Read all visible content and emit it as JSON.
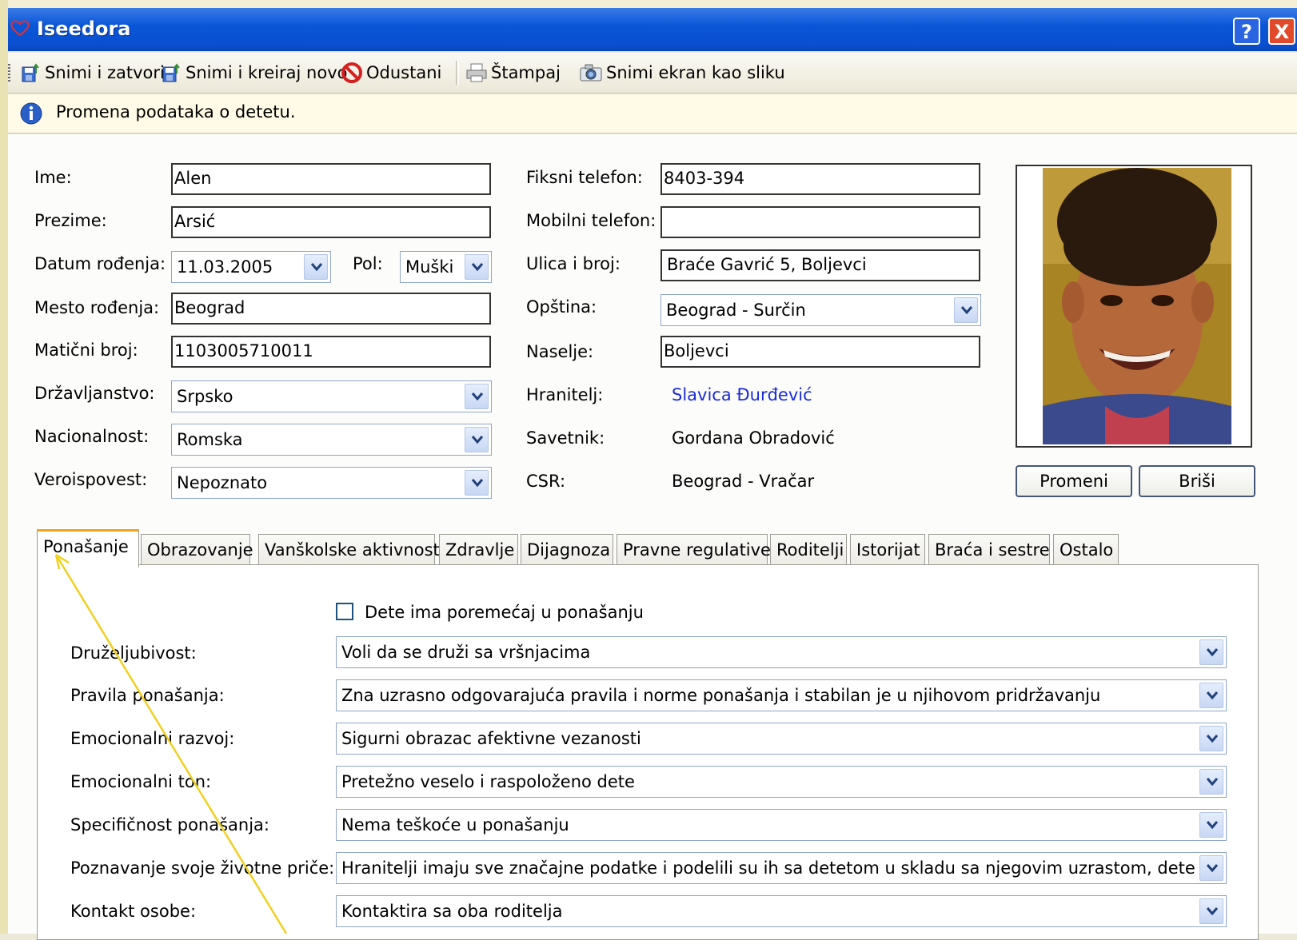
{
  "window": {
    "title": "Iseedora",
    "help_label": "?",
    "close_label": "X"
  },
  "toolbar": {
    "save_close": "Snimi i zatvori",
    "save_new": "Snimi i kreiraj novo",
    "cancel": "Odustani",
    "print": "Štampaj",
    "screenshot": "Snimi ekran kao sliku"
  },
  "info": {
    "message": "Promena podataka o detetu."
  },
  "form": {
    "ime": {
      "label": "Ime:",
      "value": "Alen"
    },
    "prezime": {
      "label": "Prezime:",
      "value": "Arsić"
    },
    "datum": {
      "label": "Datum rođenja:",
      "value": "11.03.2005"
    },
    "pol": {
      "label": "Pol:",
      "value": "Muški"
    },
    "mesto": {
      "label": "Mesto rođenja:",
      "value": "Beograd"
    },
    "maticni": {
      "label": "Matični broj:",
      "value": "1103005710011"
    },
    "drzavljanstvo": {
      "label": "Državljanstvo:",
      "value": "Srpsko"
    },
    "nacionalnost": {
      "label": "Nacionalnost:",
      "value": "Romska"
    },
    "veroispovest": {
      "label": "Veroispovest:",
      "value": "Nepoznato"
    },
    "fiksni": {
      "label": "Fiksni telefon:",
      "value": "8403-394"
    },
    "mobilni": {
      "label": "Mobilni telefon:",
      "value": ""
    },
    "ulica": {
      "label": "Ulica i broj:",
      "value": "Braće Gavrić 5, Boljevci"
    },
    "opstina": {
      "label": "Opština:",
      "value": "Beograd - Surčin"
    },
    "naselje": {
      "label": "Naselje:",
      "value": "Boljevci"
    },
    "hranitelj": {
      "label": "Hranitelj:",
      "value": "Slavica Đurđević"
    },
    "savetnik": {
      "label": "Savetnik:",
      "value": "Gordana Obradović"
    },
    "csr": {
      "label": "CSR:",
      "value": "Beograd - Vračar"
    }
  },
  "photo": {
    "change": "Promeni",
    "delete": "Briši"
  },
  "tabs": [
    "Ponašanje",
    "Obrazovanje",
    "Vanškolske aktivnosti",
    "Zdravlje",
    "Dijagnoza",
    "Pravne regulative",
    "Roditelji",
    "Istorijat",
    "Braća i sestre",
    "Ostalo"
  ],
  "behavior": {
    "checkbox_label": "Dete ima poremećaj u ponašanju",
    "checked": false,
    "rows": [
      {
        "label": "Druželjubivost:",
        "value": "Voli da se druži sa vršnjacima"
      },
      {
        "label": "Pravila ponašanja:",
        "value": "Zna uzrasno odgovarajuća pravila i norme ponašanja i stabilan je u njihovom pridržavanju"
      },
      {
        "label": "Emocionalni razvoj:",
        "value": "Sigurni obrazac afektivne vezanosti"
      },
      {
        "label": "Emocionalni ton:",
        "value": "Pretežno veselo i raspoloženo dete"
      },
      {
        "label": "Specifičnost ponašanja:",
        "value": "Nema teškoće u ponašanju"
      },
      {
        "label": "Poznavanje svoje životne priče:",
        "value": "Hranitelji imaju sve značajne podatke i podelili su ih sa detetom u skladu sa njegovim uzrastom, dete zna svoju li"
      },
      {
        "label": "Kontakt osobe:",
        "value": "Kontaktira sa oba roditelja"
      }
    ]
  },
  "colors": {
    "titlebar": "#0a56d8",
    "active_tab_accent": "#f3a41b",
    "link": "#1a2bd8",
    "annotation_arrow": "#f0d020"
  }
}
